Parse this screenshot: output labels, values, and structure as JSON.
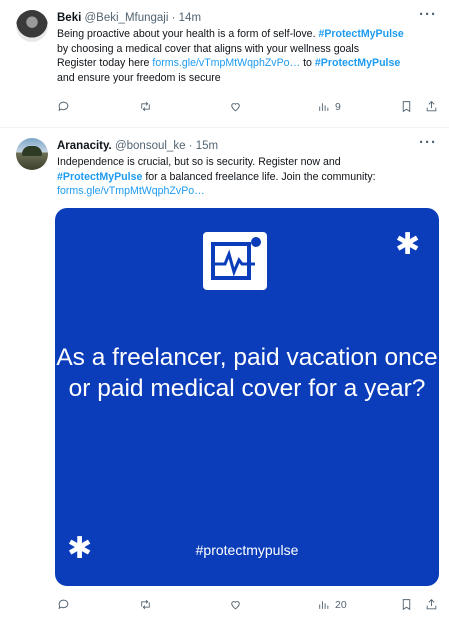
{
  "tweets": [
    {
      "name": "Beki",
      "handle": "@Beki_Mfungaji",
      "time": "· 14m",
      "text_lines": [
        [
          {
            "t": "Being proactive about your health is a form of self-love. "
          },
          {
            "t": "#ProtectMyPulse",
            "c": "tag"
          }
        ],
        [
          {
            "t": "by choosing a medical cover that aligns with your wellness goals"
          }
        ],
        [
          {
            "t": " Register today here "
          },
          {
            "t": "forms.gle/vTmpMtWqphZvPo…",
            "c": "link"
          },
          {
            "t": " to "
          },
          {
            "t": "#ProtectMyPulse",
            "c": "tag"
          }
        ],
        [
          {
            "t": "and ensure your freedom is secure"
          }
        ]
      ],
      "views": "9"
    },
    {
      "name": "Aranacity.",
      "handle": "@bonsoul_ke",
      "time": "· 15m",
      "text_lines": [
        [
          {
            "t": "Independence is crucial, but so is security. Register now and"
          }
        ],
        [
          {
            "t": "#ProtectMyPulse",
            "c": "tag"
          },
          {
            "t": " for a balanced freelance life. Join the community:"
          }
        ],
        [
          {
            "t": "forms.gle/vTmpMtWqphZvPo…",
            "c": "link"
          }
        ]
      ],
      "views": "20"
    }
  ],
  "card": {
    "headline": "As a freelancer, paid vacation once or paid medical cover for a year?",
    "hashtag": "#protectmypulse",
    "star_glyph": "✱",
    "background": "#0b3dba"
  },
  "icons": {
    "more": "more-dots-icon",
    "reply": "reply-icon",
    "retweet": "retweet-icon",
    "like": "heart-icon",
    "views": "views-icon",
    "bookmark": "bookmark-icon",
    "share": "share-icon"
  },
  "colors": {
    "accent": "#1d9bf0",
    "text": "#0f1419",
    "muted": "#536471"
  }
}
